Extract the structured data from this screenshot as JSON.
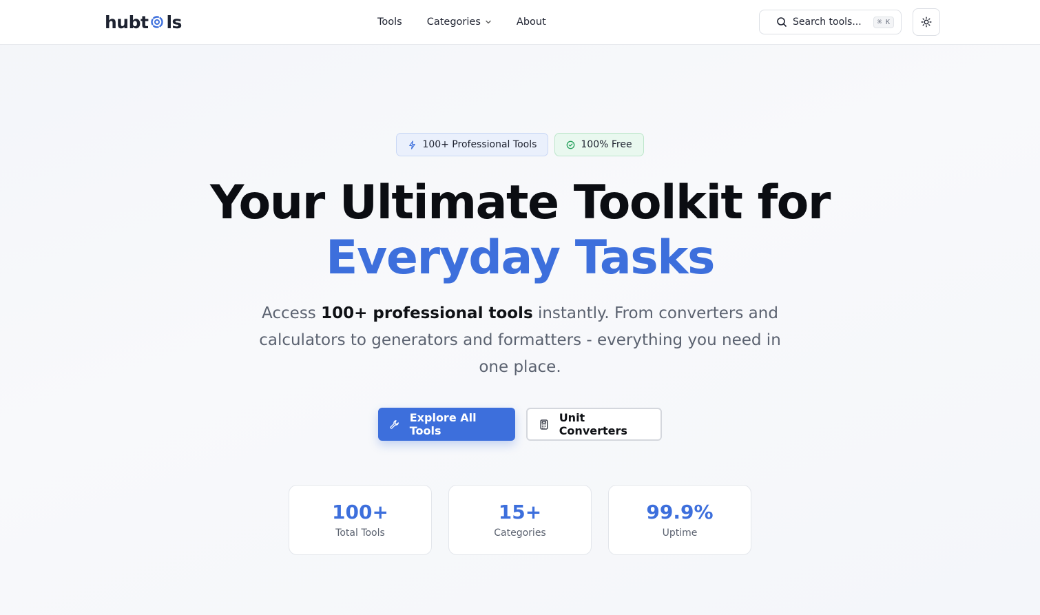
{
  "brand": {
    "logo_prefix": "hubt",
    "logo_suffix": "ls",
    "logo_icon": "gear-icon",
    "accent_color": "#3d6fdc"
  },
  "nav": {
    "items": [
      {
        "label": "Tools"
      },
      {
        "label": "Categories",
        "icon": "chevron-down-icon"
      },
      {
        "label": "About"
      }
    ]
  },
  "search": {
    "label": "Search tools...",
    "shortcut": "⌘ K",
    "icon": "search-icon"
  },
  "theme_toggle": {
    "icon": "sun-icon"
  },
  "badges": [
    {
      "label": "100+ Professional Tools",
      "icon": "lightning-icon",
      "color": "#3d6fdc"
    },
    {
      "label": "100% Free",
      "icon": "check-circle-icon",
      "color": "#22a05a"
    }
  ],
  "hero": {
    "title_line1": "Your Ultimate Toolkit for",
    "title_line2": "Everyday Tasks",
    "desc_prefix": "Access ",
    "desc_strong": "100+ professional tools",
    "desc_suffix": " instantly. From converters and calculators to generators and formatters - everything you need in one place."
  },
  "cta": {
    "primary_label": "Explore All Tools",
    "primary_icon": "wrench-icon",
    "secondary_label": "Unit Converters",
    "secondary_icon": "calculator-icon"
  },
  "stats": [
    {
      "value": "100+",
      "label": "Total Tools"
    },
    {
      "value": "15+",
      "label": "Categories"
    },
    {
      "value": "99.9%",
      "label": "Uptime"
    }
  ]
}
